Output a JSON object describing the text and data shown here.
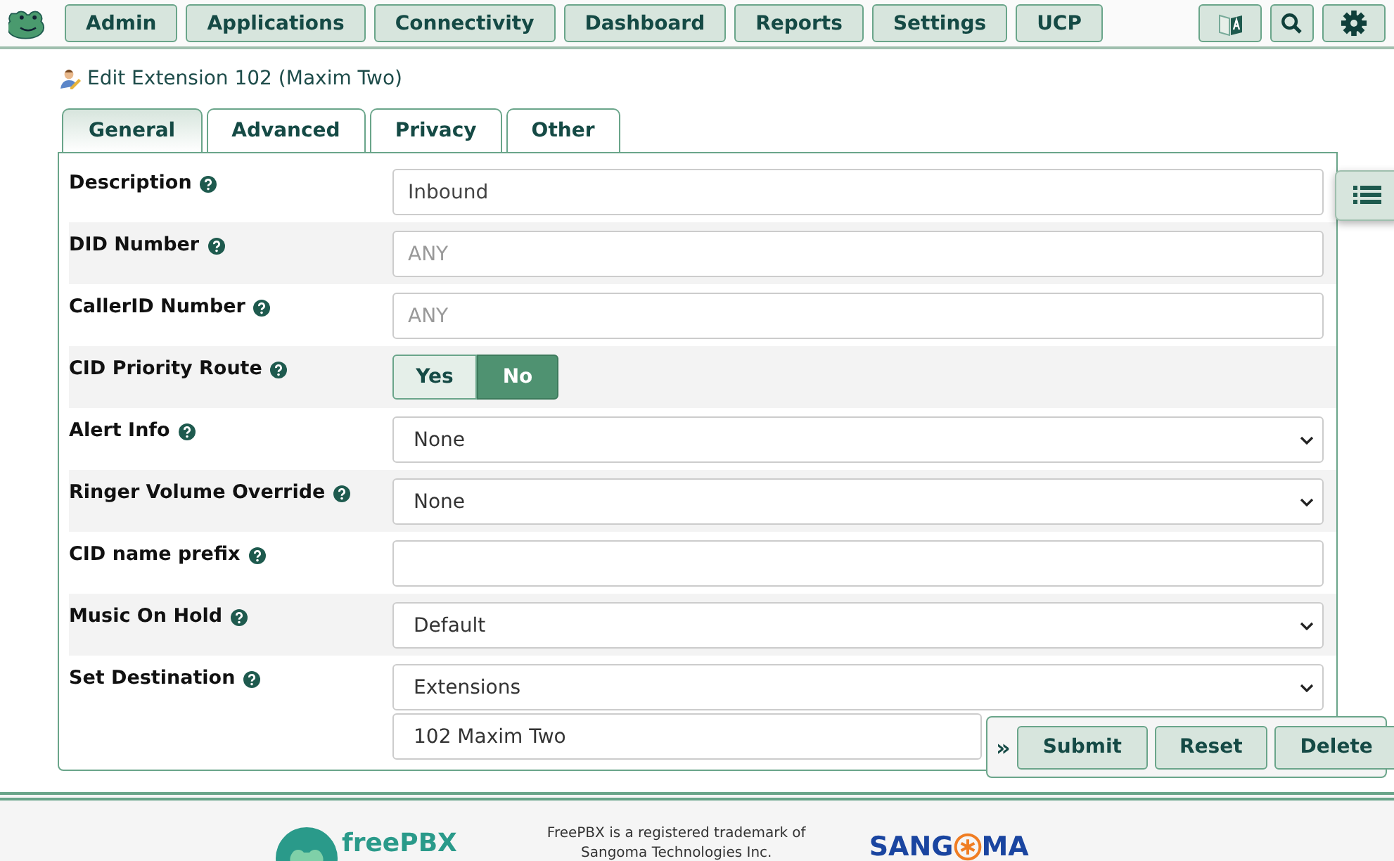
{
  "nav": {
    "items": [
      {
        "label": "Admin"
      },
      {
        "label": "Applications"
      },
      {
        "label": "Connectivity"
      },
      {
        "label": "Dashboard"
      },
      {
        "label": "Reports"
      },
      {
        "label": "Settings"
      },
      {
        "label": "UCP"
      }
    ]
  },
  "page_title": "Edit Extension 102 (Maxim Two)",
  "tabs": [
    {
      "label": "General",
      "selected": true
    },
    {
      "label": "Advanced",
      "selected": false
    },
    {
      "label": "Privacy",
      "selected": false
    },
    {
      "label": "Other",
      "selected": false
    }
  ],
  "fields": [
    {
      "label": "Description",
      "kind": "text",
      "value": "Inbound"
    },
    {
      "label": "DID Number",
      "kind": "text",
      "placeholder": "ANY"
    },
    {
      "label": "CallerID Number",
      "kind": "text",
      "placeholder": "ANY"
    },
    {
      "label": "CID Priority Route",
      "kind": "toggle",
      "options": [
        {
          "label": "Yes",
          "selected": false
        },
        {
          "label": "No",
          "selected": true
        }
      ]
    },
    {
      "label": "Alert Info",
      "kind": "select",
      "value": "None"
    },
    {
      "label": "Ringer Volume Override",
      "kind": "select",
      "value": "None"
    },
    {
      "label": "CID name prefix",
      "kind": "text"
    },
    {
      "label": "Music On Hold",
      "kind": "select",
      "value": "Default"
    },
    {
      "label": "Set Destination",
      "kind": "destination",
      "value": "Extensions",
      "second_value": "102 Maxim Two"
    }
  ],
  "actions": [
    "Submit",
    "Reset",
    "Delete"
  ],
  "expand_glyph": "»",
  "footer": {
    "logo_left": "freePBX",
    "trademark": "FreePBX is a registered trademark of\nSangoma Technologies Inc.",
    "logo_right_before": "SANG",
    "logo_right_after": "MA"
  }
}
